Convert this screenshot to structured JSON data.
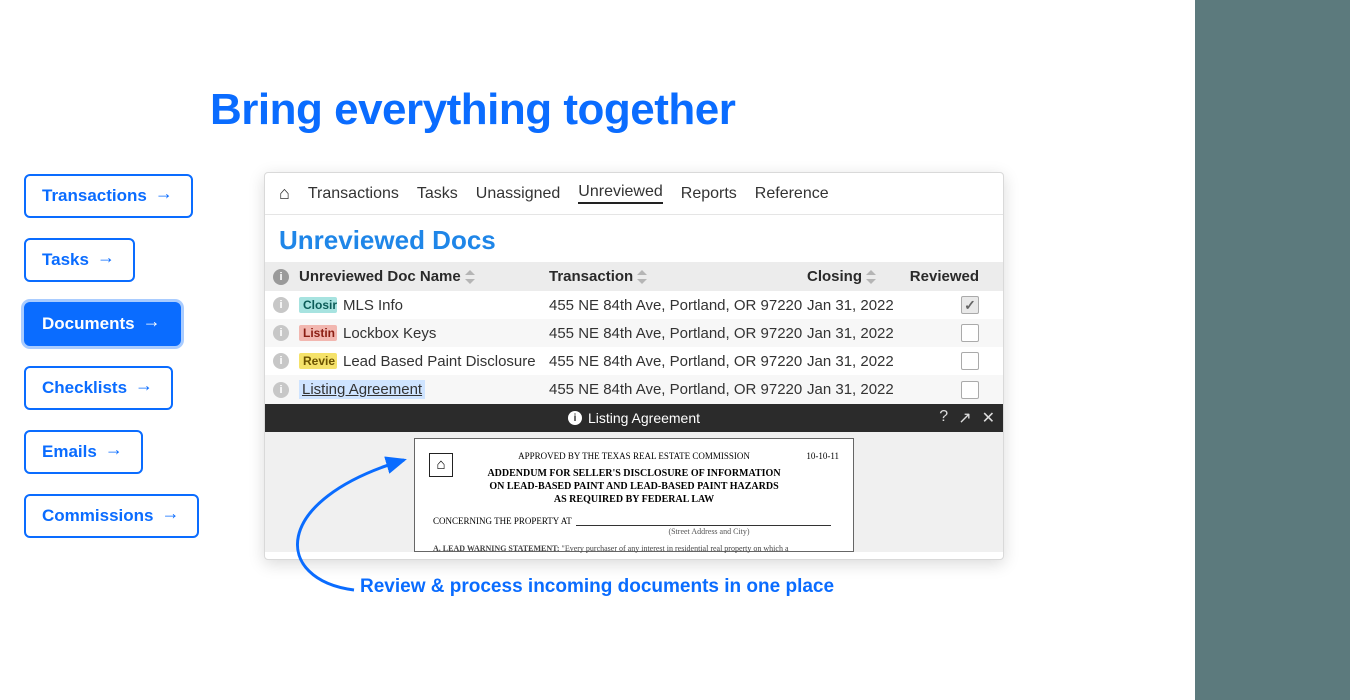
{
  "headline": "Bring everything together",
  "pills": {
    "transactions": "Transactions",
    "tasks": "Tasks",
    "documents": "Documents",
    "checklists": "Checklists",
    "emails": "Emails",
    "commissions": "Commissions"
  },
  "panel": {
    "nav": {
      "transactions": "Transactions",
      "tasks": "Tasks",
      "unassigned": "Unassigned",
      "unreviewed": "Unreviewed",
      "reports": "Reports",
      "reference": "Reference"
    },
    "title": "Unreviewed Docs",
    "headers": {
      "name": "Unreviewed Doc Name",
      "transaction": "Transaction",
      "closing": "Closing",
      "reviewed": "Reviewed"
    },
    "rows": [
      {
        "tag": "Closir",
        "tagClass": "teal",
        "name": "MLS Info",
        "transaction": "455 NE 84th Ave, Portland, OR 97220",
        "closing": "Jan 31, 2022",
        "checked": true
      },
      {
        "tag": "Listin",
        "tagClass": "red",
        "name": "Lockbox Keys",
        "transaction": "455 NE 84th Ave, Portland, OR 97220",
        "closing": "Jan 31, 2022",
        "checked": false
      },
      {
        "tag": "Revie",
        "tagClass": "yellow",
        "name": "Lead Based Paint Disclosure",
        "transaction": "455 NE 84th Ave, Portland, OR 97220",
        "closing": "Jan 31, 2022",
        "checked": false
      },
      {
        "tag": "",
        "tagClass": "",
        "name": "Listing Agreement",
        "transaction": "455 NE 84th Ave, Portland, OR 97220",
        "closing": "Jan 31, 2022",
        "checked": false,
        "highlight": true
      }
    ],
    "preview": {
      "title": "Listing Agreement",
      "doc": {
        "approved": "APPROVED BY THE TEXAS REAL ESTATE COMMISSION",
        "number": "10-10-11",
        "heading": "ADDENDUM FOR SELLER'S DISCLOSURE OF INFORMATION\nON LEAD-BASED PAINT AND LEAD-BASED PAINT HAZARDS\nAS REQUIRED BY FEDERAL LAW",
        "concerning": "CONCERNING THE PROPERTY AT",
        "sub": "(Street Address and City)",
        "para_label": "A. LEAD WARNING STATEMENT:",
        "para_text": "\"Every purchaser of any interest in residential real property on which a"
      }
    }
  },
  "caption": "Review & process incoming documents in one place"
}
